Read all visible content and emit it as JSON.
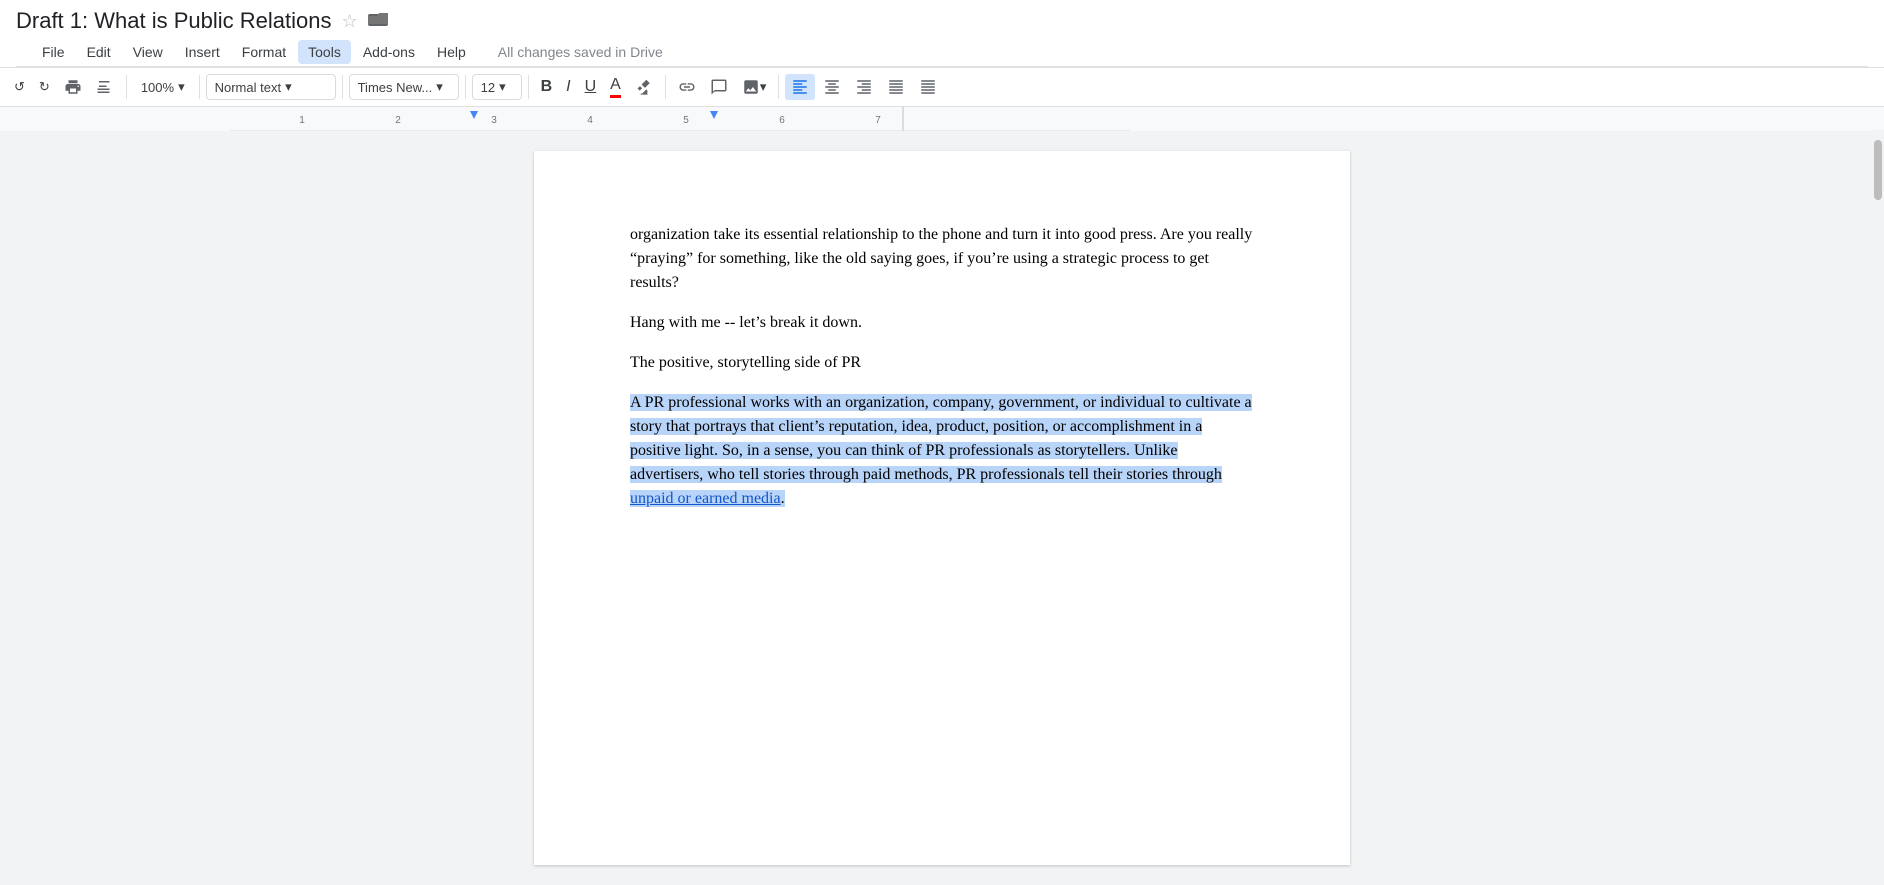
{
  "titleBar": {
    "title": "Draft 1: What is Public Relations",
    "starIcon": "☆",
    "folderIcon": "▪"
  },
  "menuBar": {
    "items": [
      "File",
      "Edit",
      "View",
      "Insert",
      "Format",
      "Tools",
      "Add-ons",
      "Help"
    ],
    "activeItem": "Tools",
    "status": "All changes saved in Drive"
  },
  "toolbar": {
    "undoIcon": "↩",
    "printIcon": "🖨",
    "paintFormatIcon": "🖌",
    "zoom": "100%",
    "zoomDropIcon": "▾",
    "styleValue": "Normal text",
    "styleDropIcon": "▾",
    "fontValue": "Times New...",
    "fontDropIcon": "▾",
    "fontSize": "12",
    "fontSizeDropIcon": "▾",
    "boldLabel": "B",
    "italicLabel": "I",
    "underlineLabel": "U",
    "textColorLabel": "A",
    "highlightLabel": "✏",
    "linkLabel": "🔗",
    "commentLabel": "+",
    "imageLabel": "🖼",
    "imageDropIcon": "▾",
    "alignLeftLabel": "≡",
    "alignCenterLabel": "≡",
    "alignRightLabel": "≡",
    "alignJustifyLabel": "≡",
    "moreLabel": "≡"
  },
  "ruler": {
    "numbers": [
      "1",
      "2",
      "3",
      "4",
      "5",
      "6",
      "7"
    ]
  },
  "document": {
    "paragraphs": [
      {
        "id": "p1",
        "text": "organization take its essential relationship to the phone and turn it into good press. Are you really “praying” for something, like the old saying goes, if you’re using a strategic process to get results?",
        "selected": false,
        "type": "normal"
      },
      {
        "id": "p2",
        "text": "Hang with me -- let’s break it down.",
        "selected": false,
        "type": "normal"
      },
      {
        "id": "p3",
        "text": "The positive, storytelling side of PR",
        "selected": false,
        "type": "normal"
      },
      {
        "id": "p4",
        "textParts": [
          {
            "text": "A PR professional works with an organization, company, government, or individual to cultivate a story that portrays that client’s reputation, idea, product, position, or accomplishment in a positive light. So, in a sense, you can think of PR professionals as storytellers. Unlike advertisers, who tell stories through paid methods, PR professionals tell their stories through ",
            "selected": true,
            "isLink": false
          },
          {
            "text": "unpaid or earned media",
            "selected": true,
            "isLink": true
          },
          {
            "text": ".",
            "selected": true,
            "isLink": false
          }
        ],
        "type": "mixed"
      },
      {
        "id": "p5",
        "text": "",
        "selected": false,
        "type": "normal"
      }
    ]
  }
}
